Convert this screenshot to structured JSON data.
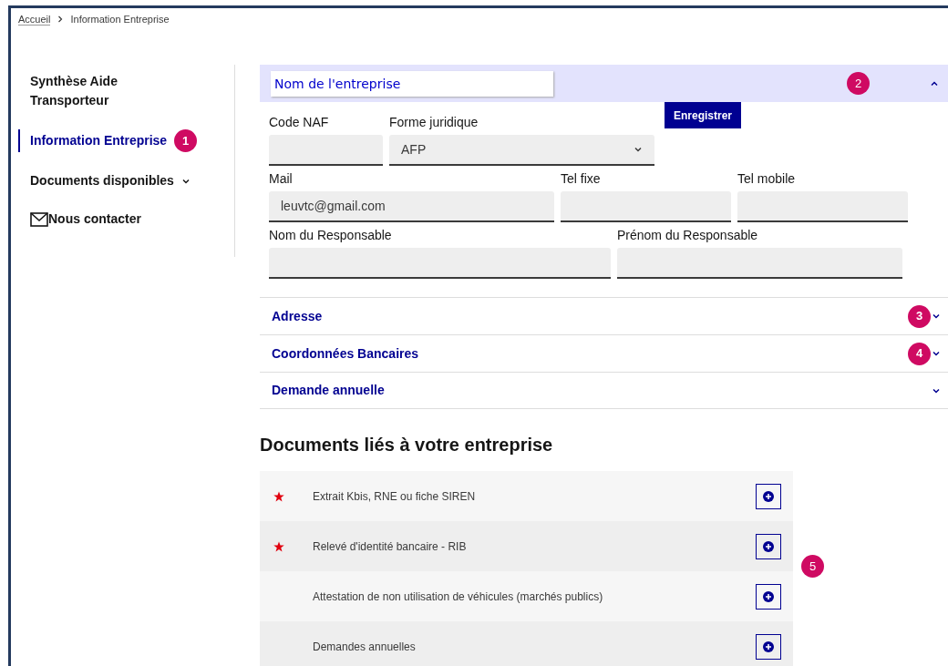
{
  "breadcrumb": [
    {
      "label": "Accueil",
      "link": true
    },
    {
      "label": "Information Entreprise",
      "link": false
    }
  ],
  "sidebar": {
    "items": [
      {
        "label": "Synthèse Aide Transporteur",
        "selected": false,
        "kind": "plain"
      },
      {
        "label": "Information Entreprise",
        "selected": true,
        "kind": "plain",
        "annotation": "1"
      },
      {
        "label": "Documents disponibles",
        "selected": false,
        "kind": "dropdown",
        "expanded": false
      },
      {
        "label": "Nous contacter",
        "selected": false,
        "kind": "mail"
      }
    ]
  },
  "company_section": {
    "name_field": {
      "value": "Nom de l'entreprise"
    },
    "expanded": true,
    "annotation": "2",
    "save_button": "Enregistrer",
    "field_rows": [
      [
        {
          "label": "Code NAF",
          "kind": "text"
        },
        {
          "label": "Forme juridique",
          "kind": "select",
          "value": "AFP"
        }
      ],
      [
        {
          "label": "Mail",
          "kind": "text",
          "value": "leuvtc@gmail.com"
        },
        {
          "label": "Tel fixe",
          "kind": "text"
        },
        {
          "label": "Tel mobile",
          "kind": "text"
        }
      ],
      [
        {
          "label": "Nom du Responsable",
          "kind": "text"
        },
        {
          "label": "Prénom du Responsable",
          "kind": "text"
        }
      ]
    ]
  },
  "sections": [
    {
      "title": "Adresse",
      "expanded": false,
      "annotation": "3"
    },
    {
      "title": "Coordonnées Bancaires",
      "expanded": false,
      "annotation": "4"
    },
    {
      "title": "Demande annuelle",
      "expanded": false
    }
  ],
  "documents": {
    "title": "Documents liés à votre entreprise",
    "annotation": "5",
    "rows": [
      {
        "label": "Extrait Kbis, RNE ou fiche SIREN",
        "required": true
      },
      {
        "label": "Relevé d'identité bancaire - RIB",
        "required": true
      },
      {
        "label": "Attestation de non utilisation de véhicules (marchés publics)",
        "required": false
      },
      {
        "label": "Demandes annuelles",
        "required": false
      }
    ]
  }
}
